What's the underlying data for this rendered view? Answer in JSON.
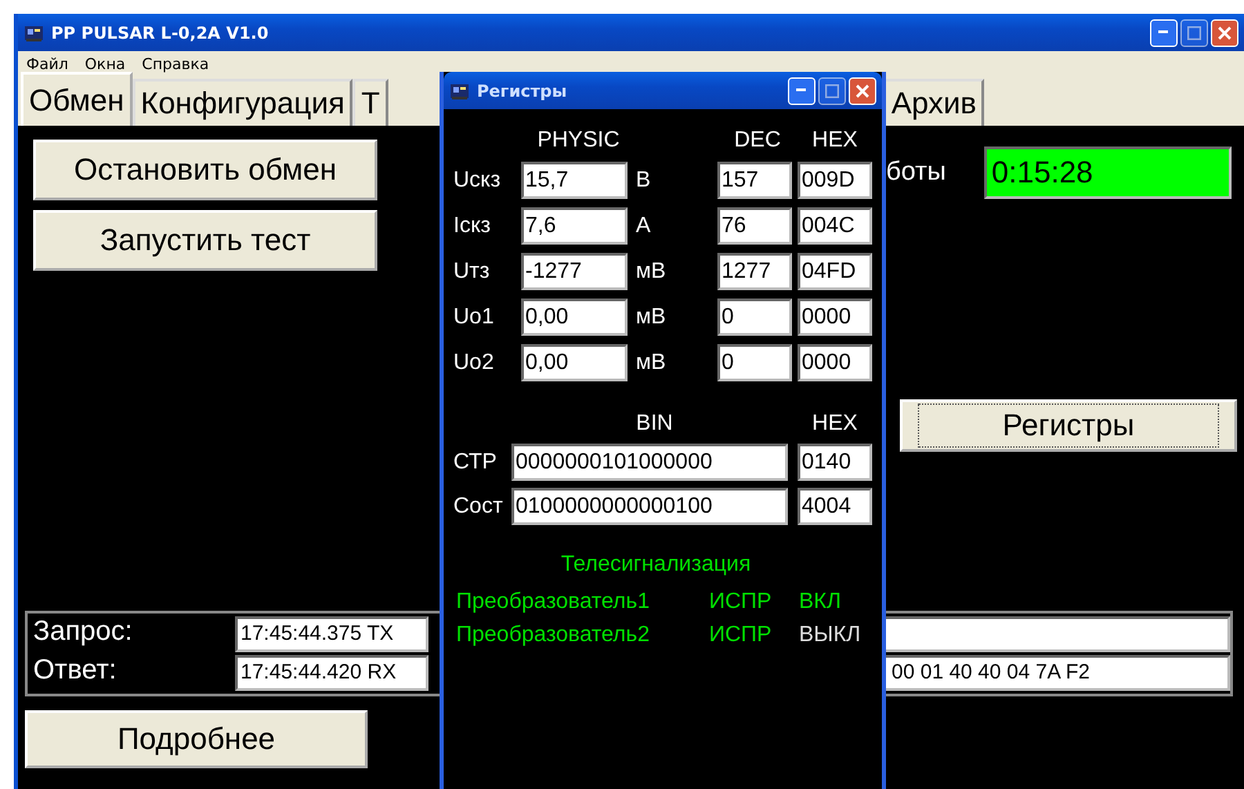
{
  "main_window": {
    "title": "PP PULSAR L-0,2A V1.0",
    "menu": [
      "Файл",
      "Окна",
      "Справка"
    ],
    "tabs": [
      {
        "label": "Обмен",
        "selected": true
      },
      {
        "label": "Конфигурация",
        "selected": false
      },
      {
        "label": "Т",
        "selected": false
      },
      {
        "label": "Архив",
        "selected": false
      }
    ],
    "buttons": {
      "stop": "Остановить обмен",
      "test": "Запустить тест",
      "registers": "Регистры",
      "details": "Подробнее"
    },
    "uptime": {
      "label": "боты",
      "value": "0:15:28"
    },
    "log": {
      "request_label": "Запрос:",
      "request": "17:45:44.375 TX",
      "response_label": "Ответ:",
      "response": "17:45:44.420 RX",
      "response_tail": "00 01 40 40 04 7A F2"
    }
  },
  "registers_window": {
    "title": "Регистры",
    "columns": {
      "physic": "PHYSIC",
      "dec": "DEC",
      "hex": "HEX"
    },
    "registers": [
      {
        "name": "Uскз",
        "physic": "15,7",
        "unit": "В",
        "dec": "157",
        "hex": "009D"
      },
      {
        "name": "Iскз",
        "physic": "7,6",
        "unit": "А",
        "dec": "76",
        "hex": "004C"
      },
      {
        "name": "Uтз",
        "physic": "-1277",
        "unit": "мВ",
        "dec": "1277",
        "hex": "04FD"
      },
      {
        "name": "Uo1",
        "physic": "0,00",
        "unit": "мВ",
        "dec": "0",
        "hex": "0000"
      },
      {
        "name": "Uo2",
        "physic": "0,00",
        "unit": "мВ",
        "dec": "0",
        "hex": "0000"
      }
    ],
    "bin_columns": {
      "bin": "BIN",
      "hex": "HEX"
    },
    "words": [
      {
        "name": "СТР",
        "bin": "0000000101000000",
        "hex": "0140"
      },
      {
        "name": "Сост",
        "bin": "0100000000000100",
        "hex": "4004"
      }
    ],
    "signals_title": "Телесигнализация",
    "signals": [
      {
        "name": "Преобразователь1",
        "status": "ИСПР",
        "state": "ВКЛ",
        "on": true
      },
      {
        "name": "Преобразователь2",
        "status": "ИСПР",
        "state": "ВЫКЛ",
        "on": false
      }
    ]
  }
}
